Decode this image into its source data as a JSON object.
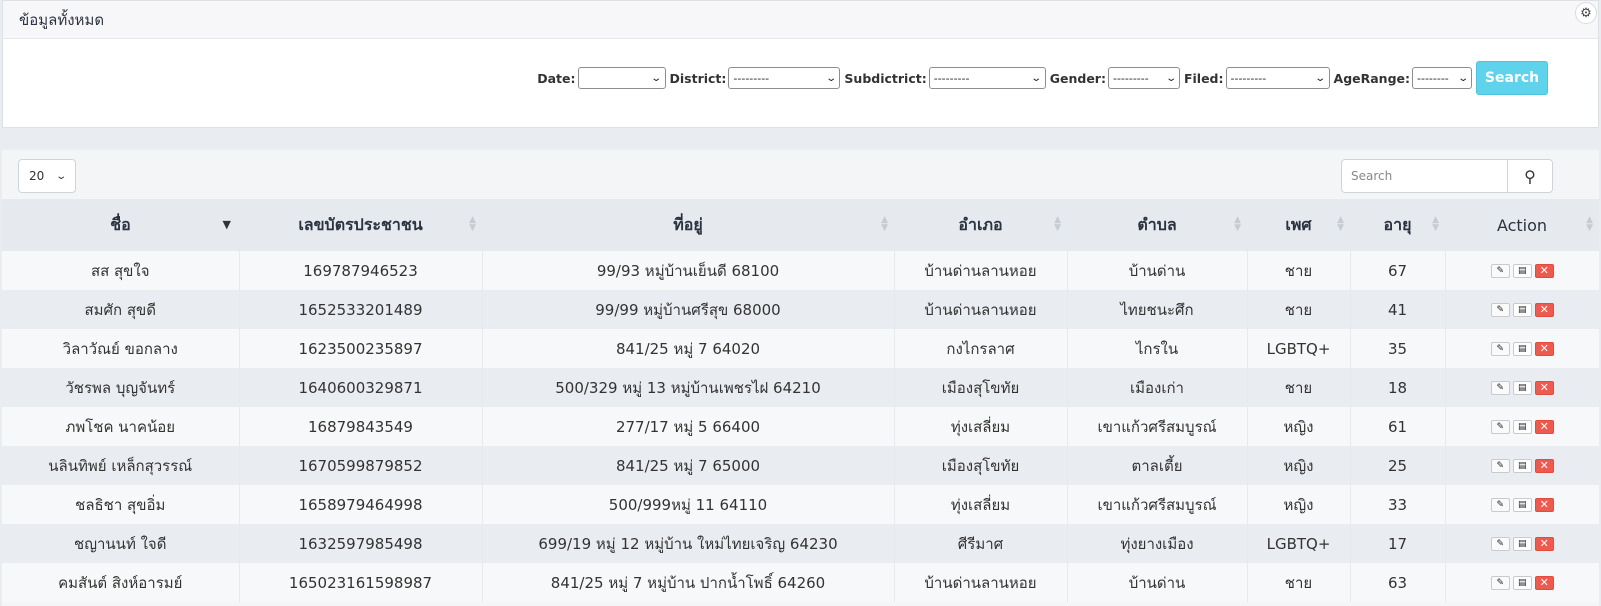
{
  "header": {
    "title": "ข้อมูลทั้งหมด"
  },
  "filters": {
    "date": {
      "label": "Date:",
      "value": ""
    },
    "district": {
      "label": "District:",
      "value": "---------"
    },
    "subdistrict": {
      "label": "Subdictrict:",
      "value": "---------"
    },
    "gender": {
      "label": "Gender:",
      "value": "---------"
    },
    "filed": {
      "label": "Filed:",
      "value": "---------"
    },
    "agerange": {
      "label": "AgeRange:",
      "value": "--------"
    },
    "search_label": "Search"
  },
  "table_controls": {
    "page_length": "20",
    "search_placeholder": "Search"
  },
  "table": {
    "columns": [
      "ชื่อ",
      "เลขบัตรประชาชน",
      "ที่อยู่",
      "อำเภอ",
      "ตำบล",
      "เพศ",
      "อายุ",
      "Action"
    ],
    "rows": [
      [
        "สส สุขใจ",
        "169787946523",
        "99/93 หมู่บ้านเย็นดี 68100",
        "บ้านด่านลานหอย",
        "บ้านด่าน",
        "ชาย",
        "67"
      ],
      [
        "สมศัก สุขดี",
        "1652533201489",
        "99/99 หมู่บ้านศรีสุข 68000",
        "บ้านด่านลานหอย",
        "ไทยชนะศึก",
        "ชาย",
        "41"
      ],
      [
        "วิลาวัณย์ ขอกลาง",
        "1623500235897",
        "841/25 หมู่ 7 64020",
        "กงไกรลาศ",
        "ไกรใน",
        "LGBTQ+",
        "35"
      ],
      [
        "วัชรพล บุญจันทร์",
        "1640600329871",
        "500/329 หมู่ 13 หมู่บ้านเพชรไฝ 64210",
        "เมืองสุโขทัย",
        "เมืองเก่า",
        "ชาย",
        "18"
      ],
      [
        "ภพโชค นาคน้อย",
        "16879843549",
        "277/17 หมู่ 5 66400",
        "ทุ่งเสลี่ยม",
        "เขาแก้วศรีสมบูรณ์",
        "หญิง",
        "61"
      ],
      [
        "นลินทิพย์ เหล็กสุวรรณ์",
        "1670599879852",
        "841/25 หมู่ 7 65000",
        "เมืองสุโขทัย",
        "ตาลเตี้ย",
        "หญิง",
        "25"
      ],
      [
        "ชลธิชา สุขอิ่ม",
        "1658979464998",
        "500/999หมู่ 11 64110",
        "ทุ่งเสลี่ยม",
        "เขาแก้วศรีสมบูรณ์",
        "หญิง",
        "33"
      ],
      [
        "ชญานนท์ ใจดี",
        "1632597985498",
        "699/19 หมู่ 12 หมู่บ้าน ใหม่ไทยเจริญ 64230",
        "ศีรีมาศ",
        "ทุ่งยางเมือง",
        "LGBTQ+",
        "17"
      ],
      [
        "คมสันต์ สิงห์อารมย์",
        "165023161598987",
        "841/25 หมู่ 7 หมู่บ้าน ปากน้ำโพธิ์ 64260",
        "บ้านด่านลานหอย",
        "บ้านด่าน",
        "ชาย",
        "63"
      ]
    ]
  },
  "colors": {
    "search_button": "#5fd3ec",
    "delete_button": "#ef5a4f"
  }
}
